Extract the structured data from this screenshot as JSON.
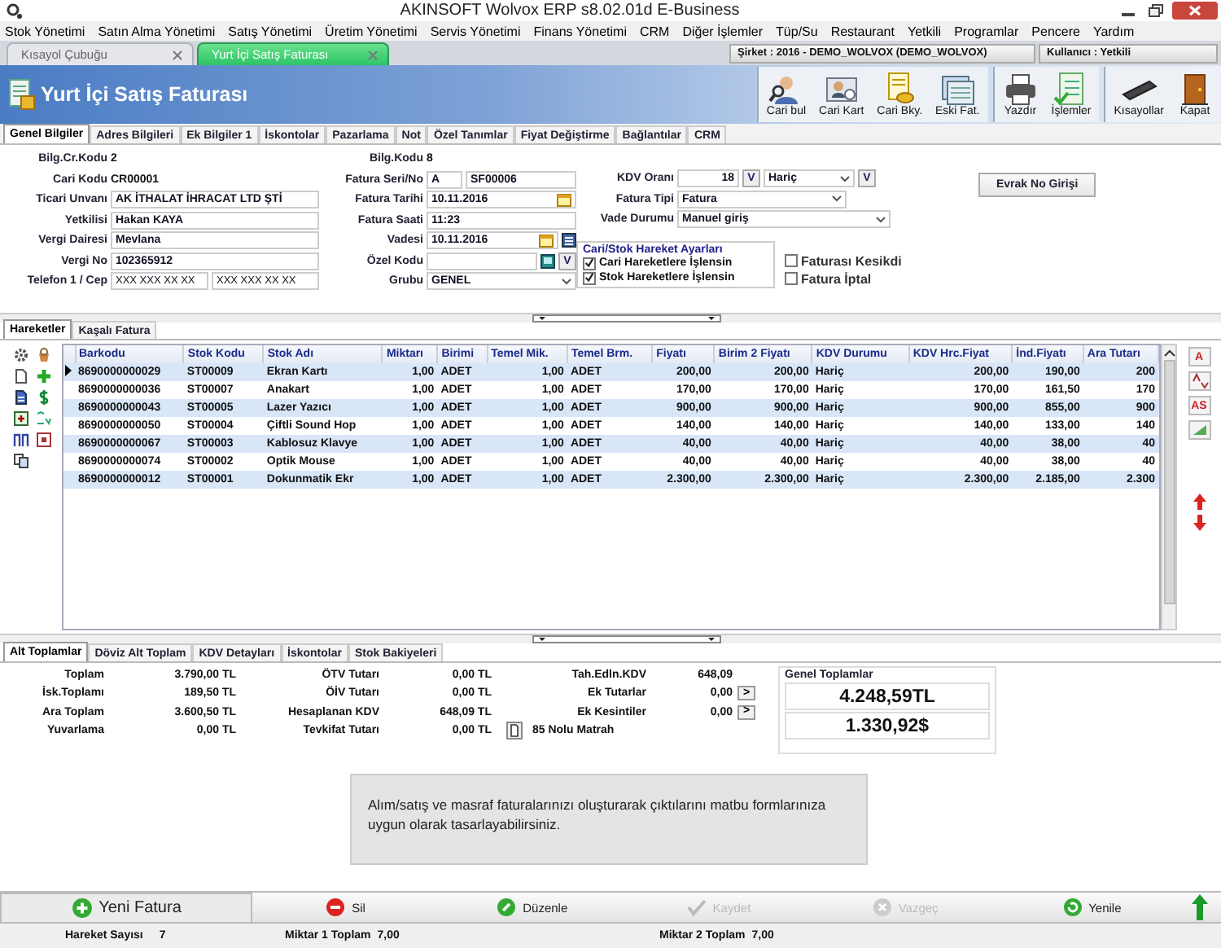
{
  "window": {
    "title": "AKINSOFT Wolvox ERP s8.02.01d  E-Business"
  },
  "menu": [
    "Stok Yönetimi",
    "Satın Alma Yönetimi",
    "Satış Yönetimi",
    "Üretim Yönetimi",
    "Servis Yönetimi",
    "Finans Yönetimi",
    "CRM",
    "Diğer İşlemler",
    "Tüp/Su",
    "Restaurant",
    "Yetkili",
    "Programlar",
    "Pencere",
    "Yardım"
  ],
  "doc_tabs": [
    {
      "label": "Kısayol Çubuğu",
      "selected": false
    },
    {
      "label": "Yurt İçi Satış Faturası",
      "selected": true
    }
  ],
  "session": {
    "company": "Şirket : 2016 - DEMO_WOLVOX (DEMO_WOLVOX)",
    "user": "Kullanıcı : Yetkili"
  },
  "header": {
    "title": "Yurt İçi Satış Faturası",
    "tool_groups": [
      [
        {
          "label": "Cari bul",
          "kind": "search"
        },
        {
          "label": "Cari Kart",
          "kind": "card"
        },
        {
          "label": "Cari Bky.",
          "kind": "balance"
        },
        {
          "label": "Eski Fat.",
          "kind": "archive"
        }
      ],
      [
        {
          "label": "Yazdır",
          "kind": "print"
        },
        {
          "label": "İşlemler",
          "kind": "operations"
        }
      ],
      [
        {
          "label": "Kısayollar",
          "kind": "shortcuts"
        },
        {
          "label": "Kapat",
          "kind": "exit"
        }
      ]
    ]
  },
  "form_tabs": [
    {
      "label": "Genel Bilgiler",
      "selected": true
    },
    {
      "label": "Adres Bilgileri",
      "selected": false
    },
    {
      "label": "Ek Bilgiler 1",
      "selected": false
    },
    {
      "label": "İskontolar",
      "selected": false
    },
    {
      "label": "Pazarlama",
      "selected": false
    },
    {
      "label": "Not",
      "selected": false
    },
    {
      "label": "Özel Tanımlar",
      "selected": false
    },
    {
      "label": "Fiyat Değiştirme",
      "selected": false
    },
    {
      "label": "Bağlantılar",
      "selected": false
    },
    {
      "label": "CRM",
      "selected": false
    }
  ],
  "form": {
    "left": [
      {
        "label": "Bilg.Cr.Kodu",
        "value": "2",
        "kind": "plain"
      },
      {
        "label": "Cari Kodu",
        "value": "CR00001",
        "kind": "plain"
      },
      {
        "label": "Ticari Unvanı",
        "value": "AK İTHALAT İHRACAT LTD ŞTİ",
        "kind": "field"
      },
      {
        "label": "Yetkilisi",
        "value": "Hakan KAYA",
        "kind": "field"
      },
      {
        "label": "Vergi Dairesi",
        "value": "Mevlana",
        "kind": "field"
      },
      {
        "label": "Vergi No",
        "value": "102365912",
        "kind": "field"
      },
      {
        "label": "Telefon 1 / Cep",
        "values": [
          "XXX XXX XX XX",
          "XXX XXX XX XX"
        ],
        "kind": "pair"
      }
    ],
    "middle": [
      {
        "label": "Bilg.Kodu",
        "value": "8",
        "kind": "plain"
      },
      {
        "label": "Fatura Seri/No",
        "values": [
          "A",
          "SF00006"
        ],
        "kind": "pair"
      },
      {
        "label": "Fatura Tarihi",
        "value": "10.11.2016",
        "kind": "date"
      },
      {
        "label": "Fatura Saati",
        "value": "11:23",
        "kind": "field"
      },
      {
        "label": "Vadesi",
        "value": "10.11.2016",
        "kind": "date2"
      },
      {
        "label": "Özel Kodu",
        "button": "V",
        "kind": "code"
      },
      {
        "label": "Grubu",
        "value": "GENEL",
        "kind": "select"
      }
    ],
    "right": [
      {
        "label": "KDV Oranı",
        "value": "18",
        "option": "Hariç",
        "buttons": [
          "V",
          "V"
        ],
        "kind": "kdv"
      },
      {
        "label": "Fatura Tipi",
        "value": "Fatura",
        "kind": "select"
      },
      {
        "label": "Vade Durumu",
        "value": "Manuel giriş",
        "kind": "select"
      }
    ],
    "evrak_button": "Evrak No Girişi",
    "settings": {
      "title": "Cari/Stok Hareket Ayarları",
      "options": [
        {
          "label": "Cari Hareketlere İşlensin",
          "checked": true
        },
        {
          "label": "Stok Hareketlere İşlensin",
          "checked": true
        }
      ]
    },
    "flags": [
      {
        "label": "Faturası Kesikdi",
        "checked": false
      },
      {
        "label": "Fatura İptal",
        "checked": false
      }
    ]
  },
  "grid_tabs": [
    {
      "label": "Hareketler",
      "selected": true
    },
    {
      "label": "Kaşalı Fatura",
      "selected": false
    }
  ],
  "table": {
    "columns": [
      {
        "label": "Barkodu",
        "kind": "text"
      },
      {
        "label": "Stok Kodu",
        "kind": "text"
      },
      {
        "label": "Stok Adı",
        "kind": "text"
      },
      {
        "label": "Miktarı",
        "kind": "number"
      },
      {
        "label": "Birimi",
        "kind": "text"
      },
      {
        "label": "Temel Mik.",
        "kind": "number"
      },
      {
        "label": "Temel Brm.",
        "kind": "text"
      },
      {
        "label": "Fiyatı",
        "kind": "number"
      },
      {
        "label": "Birim 2 Fiyatı",
        "kind": "number"
      },
      {
        "label": "KDV Durumu",
        "kind": "text"
      },
      {
        "label": "KDV Hrc.Fiyat",
        "kind": "number"
      },
      {
        "label": "İnd.Fiyatı",
        "kind": "number"
      },
      {
        "label": "Ara Tutarı",
        "kind": "number"
      }
    ],
    "rows": [
      {
        "selected": true,
        "cells": [
          "8690000000029",
          "ST00009",
          "Ekran  Kartı",
          "1,00",
          "ADET",
          "1,00",
          "ADET",
          "200,00",
          "200,00",
          "Hariç",
          "200,00",
          "190,00",
          "200"
        ]
      },
      {
        "selected": false,
        "cells": [
          "8690000000036",
          "ST00007",
          "Anakart",
          "1,00",
          "ADET",
          "1,00",
          "ADET",
          "170,00",
          "170,00",
          "Hariç",
          "170,00",
          "161,50",
          "170"
        ]
      },
      {
        "selected": false,
        "cells": [
          "8690000000043",
          "ST00005",
          "Lazer Yazıcı",
          "1,00",
          "ADET",
          "1,00",
          "ADET",
          "900,00",
          "900,00",
          "Hariç",
          "900,00",
          "855,00",
          "900"
        ]
      },
      {
        "selected": false,
        "cells": [
          "8690000000050",
          "ST00004",
          "Çiftli Sound Hop",
          "1,00",
          "ADET",
          "1,00",
          "ADET",
          "140,00",
          "140,00",
          "Hariç",
          "140,00",
          "133,00",
          "140"
        ]
      },
      {
        "selected": false,
        "cells": [
          "8690000000067",
          "ST00003",
          "Kablosuz Klavye",
          "1,00",
          "ADET",
          "1,00",
          "ADET",
          "40,00",
          "40,00",
          "Hariç",
          "40,00",
          "38,00",
          "40"
        ]
      },
      {
        "selected": false,
        "cells": [
          "8690000000074",
          "ST00002",
          "Optik Mouse",
          "1,00",
          "ADET",
          "1,00",
          "ADET",
          "40,00",
          "40,00",
          "Hariç",
          "40,00",
          "38,00",
          "40"
        ]
      },
      {
        "selected": false,
        "cells": [
          "8690000000012",
          "ST00001",
          "Dokunmatik Ekr",
          "1,00",
          "ADET",
          "1,00",
          "ADET",
          "2.300,00",
          "2.300,00",
          "Hariç",
          "2.300,00",
          "2.185,00",
          "2.300"
        ]
      }
    ]
  },
  "side_tools": [
    {
      "kind": "text",
      "label": "A"
    },
    {
      "kind": "sort"
    },
    {
      "kind": "text",
      "label": "AS"
    },
    {
      "kind": "triangle"
    },
    {
      "kind": "up"
    },
    {
      "kind": "down"
    }
  ],
  "bottom_tabs": [
    {
      "label": "Alt Toplamlar",
      "selected": true
    },
    {
      "label": "Döviz Alt Toplam",
      "selected": false
    },
    {
      "label": "KDV Detayları",
      "selected": false
    },
    {
      "label": "İskontolar",
      "selected": false
    },
    {
      "label": "Stok Bakiyeleri",
      "selected": false
    }
  ],
  "totals": [
    [
      {
        "label": "Toplam",
        "value": "3.790,00 TL",
        "kind": "pair"
      },
      {
        "label": "İsk.Toplamı",
        "value": "189,50 TL",
        "kind": "pair"
      },
      {
        "label": "Ara Toplam",
        "value": "3.600,50 TL",
        "kind": "pair"
      },
      {
        "label": "Yuvarlama",
        "value": "0,00 TL",
        "kind": "pair"
      }
    ],
    [
      {
        "label": "ÖTV Tutarı",
        "value": "0,00 TL",
        "kind": "pair"
      },
      {
        "label": "ÖİV Tutarı",
        "value": "0,00 TL",
        "kind": "pair"
      },
      {
        "label": "Hesaplanan KDV",
        "value": "648,09 TL",
        "kind": "pair"
      },
      {
        "label": "Tevkifat Tutarı",
        "value": "0,00 TL",
        "kind": "doc"
      }
    ],
    [
      {
        "label": "Tah.Edln.KDV",
        "value": "648,09",
        "kind": "pair"
      },
      {
        "label": "Ek Tutarlar",
        "value": "0,00",
        "button": ">",
        "kind": "more"
      },
      {
        "label": "Ek Kesintiler",
        "value": "0,00",
        "button": ">",
        "kind": "more"
      },
      {
        "label": "85 Nolu Matrah",
        "kind": "label"
      }
    ]
  ],
  "grand": {
    "title": "Genel Toplamlar",
    "values": [
      "4.248,59TL",
      "1.330,92$"
    ]
  },
  "message": "Alım/satış ve masraf faturalarınızı oluşturarak çıktılarını matbu formlarınıza uygun olarak tasarlayabilirsiniz.",
  "actions": [
    {
      "label": "Yeni Fatura",
      "kind": "add",
      "disabled": false
    },
    {
      "label": "Sil",
      "kind": "delete",
      "disabled": false
    },
    {
      "label": "Düzenle",
      "kind": "edit",
      "disabled": false
    },
    {
      "label": "Kaydet",
      "kind": "save",
      "disabled": true
    },
    {
      "label": "Vazgeç",
      "kind": "cancel",
      "disabled": true
    },
    {
      "label": "Yenile",
      "kind": "refresh",
      "disabled": false
    }
  ],
  "status": [
    {
      "label": "Hareket Sayısı",
      "value": "7"
    },
    {
      "label": "Miktar 1 Toplam",
      "value": "7,00"
    },
    {
      "label": "Miktar 2 Toplam",
      "value": "7,00"
    }
  ]
}
